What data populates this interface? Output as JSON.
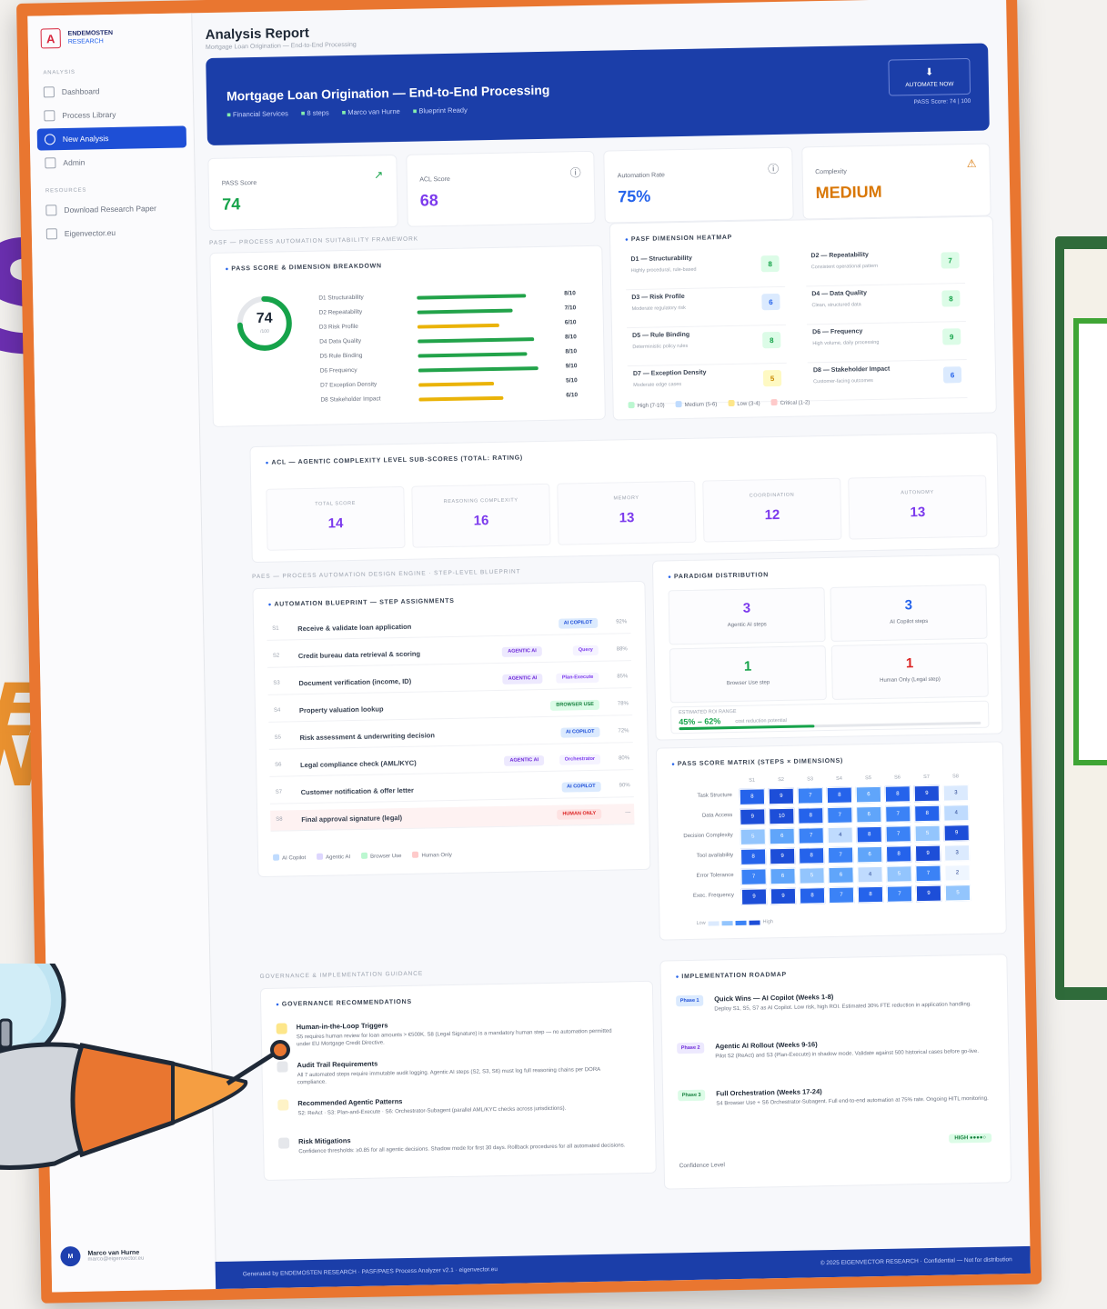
{
  "app": {
    "brand_line1": "ENDEMOSTEN",
    "brand_line2": "RESEARCH",
    "logo_glyph": "A"
  },
  "sidebar": {
    "group_analysis": "ANALYSIS",
    "items": [
      {
        "label": "Dashboard",
        "icon": "grid-icon",
        "active": false
      },
      {
        "label": "Process Library",
        "icon": "folder-icon",
        "active": false
      },
      {
        "label": "New Analysis",
        "icon": "plus-circle-icon",
        "active": true
      },
      {
        "label": "Admin",
        "icon": "chart-icon",
        "active": false
      }
    ],
    "group_resources": "RESOURCES",
    "resources": [
      {
        "label": "Download Research Paper",
        "icon": "download-icon"
      },
      {
        "label": "Eigenvector.eu",
        "icon": "link-icon"
      }
    ],
    "user_initials": "M",
    "user_name": "Marco van Hurne",
    "user_email": "marco@eigenvector.eu"
  },
  "header": {
    "title": "Analysis Report",
    "breadcrumb": "Mortgage Loan Origination — End-to-End Processing"
  },
  "hero": {
    "title": "Mortgage Loan Origination — End-to-End Processing",
    "meta": [
      "Financial Services",
      "8 steps",
      "Marco van Hurne",
      "Blueprint Ready"
    ],
    "export_label": "AUTOMATE NOW",
    "score_line": "PASS Score: 74 | 100",
    "color": "#1b3ea9"
  },
  "kpis": [
    {
      "label": "PASS Score",
      "value": "74",
      "icon": "trend-up-icon",
      "color": "#16a34a"
    },
    {
      "label": "ACL Score",
      "value": "68",
      "icon": "info-icon",
      "color": "#7c3aed"
    },
    {
      "label": "Automation Rate",
      "value": "75%",
      "icon": "info-icon",
      "color": "#2563eb"
    },
    {
      "label": "Complexity",
      "value": "MEDIUM",
      "icon": "warning-icon",
      "color": "#d97706"
    }
  ],
  "pass_section": {
    "heading": "PASF — PROCESS AUTOMATION SUITABILITY FRAMEWORK",
    "card_title": "PASS SCORE & DIMENSION BREAKDOWN",
    "donut_value": "74",
    "donut_sub": "/100",
    "donut_fraction": 0.74,
    "dimensions": [
      {
        "label": "D1 Structurability",
        "value": "8/10",
        "score": 0.8,
        "color": "#22a34a"
      },
      {
        "label": "D2 Repeatability",
        "value": "7/10",
        "score": 0.7,
        "color": "#22a34a"
      },
      {
        "label": "D3 Risk Profile",
        "value": "6/10",
        "score": 0.6,
        "color": "#eab308"
      },
      {
        "label": "D4 Data Quality",
        "value": "8/10",
        "score": 0.85,
        "color": "#22a34a"
      },
      {
        "label": "D5 Rule Binding",
        "value": "8/10",
        "score": 0.8,
        "color": "#22a34a"
      },
      {
        "label": "D6 Frequency",
        "value": "9/10",
        "score": 0.88,
        "color": "#22a34a"
      },
      {
        "label": "D7 Exception Density",
        "value": "5/10",
        "score": 0.55,
        "color": "#eab308"
      },
      {
        "label": "D8 Stakeholder Impact",
        "value": "6/10",
        "score": 0.62,
        "color": "#eab308"
      }
    ]
  },
  "heatmap": {
    "title": "PASF DIMENSION HEATMAP",
    "cells": [
      {
        "title": "D1 — Structurability",
        "sub": "Highly procedural, rule-based",
        "value": "8",
        "bg": "#dcfce7",
        "fg": "#16a34a"
      },
      {
        "title": "D2 — Repeatability",
        "sub": "Consistent operational pattern",
        "value": "7",
        "bg": "#dcfce7",
        "fg": "#16a34a"
      },
      {
        "title": "D3 — Risk Profile",
        "sub": "Moderate regulatory risk",
        "value": "6",
        "bg": "#dbeafe",
        "fg": "#2563eb"
      },
      {
        "title": "D4 — Data Quality",
        "sub": "Clean, structured data",
        "value": "8",
        "bg": "#dcfce7",
        "fg": "#16a34a"
      },
      {
        "title": "D5 — Rule Binding",
        "sub": "Deterministic policy rules",
        "value": "8",
        "bg": "#dcfce7",
        "fg": "#16a34a"
      },
      {
        "title": "D6 — Frequency",
        "sub": "High volume, daily processing",
        "value": "9",
        "bg": "#dcfce7",
        "fg": "#16a34a"
      },
      {
        "title": "D7 — Exception Density",
        "sub": "Moderate edge cases",
        "value": "5",
        "bg": "#fef9c3",
        "fg": "#ca8a04"
      },
      {
        "title": "D8 — Stakeholder Impact",
        "sub": "Customer-facing outcomes",
        "value": "6",
        "bg": "#dbeafe",
        "fg": "#2563eb"
      }
    ],
    "legend": [
      {
        "label": "High (7-10)",
        "color": "#bbf7d0"
      },
      {
        "label": "Medium (5-6)",
        "color": "#bfdbfe"
      },
      {
        "label": "Low (3-4)",
        "color": "#fde68a"
      },
      {
        "label": "Critical (1-2)",
        "color": "#fecaca"
      }
    ]
  },
  "acl": {
    "title": "ACL — AGENTIC COMPLEXITY LEVEL SUB-SCORES (TOTAL: RATING)",
    "boxes": [
      {
        "label": "TOTAL SCORE",
        "value": "14"
      },
      {
        "label": "REASONING COMPLEXITY",
        "value": "16"
      },
      {
        "label": "MEMORY",
        "value": "13"
      },
      {
        "label": "COORDINATION",
        "value": "12"
      },
      {
        "label": "AUTONOMY",
        "value": "13"
      }
    ]
  },
  "paes": {
    "heading": "PAES — PROCESS AUTOMATION DESIGN ENGINE · STEP-LEVEL BLUEPRINT",
    "card_title": "AUTOMATION BLUEPRINT — STEP ASSIGNMENTS",
    "steps": [
      {
        "id": "S1",
        "name": "Receive & validate loan application",
        "badges": [
          {
            "text": "AI COPILOT",
            "bg": "#dbeafe",
            "fg": "#1d4ed8"
          }
        ],
        "conf": "92%",
        "human": false
      },
      {
        "id": "S2",
        "name": "Credit bureau data retrieval & scoring",
        "badges": [
          {
            "text": "AGENTIC AI",
            "bg": "#ede9fe",
            "fg": "#6d28d9"
          },
          {
            "text": "Query",
            "bg": "#f5f3ff",
            "fg": "#7c3aed"
          }
        ],
        "conf": "88%",
        "human": false
      },
      {
        "id": "S3",
        "name": "Document verification (income, ID)",
        "badges": [
          {
            "text": "AGENTIC AI",
            "bg": "#ede9fe",
            "fg": "#6d28d9"
          },
          {
            "text": "Plan-Execute",
            "bg": "#f5f3ff",
            "fg": "#7c3aed"
          }
        ],
        "conf": "85%",
        "human": false
      },
      {
        "id": "S4",
        "name": "Property valuation lookup",
        "badges": [
          {
            "text": "BROWSER USE",
            "bg": "#dcfce7",
            "fg": "#15803d"
          }
        ],
        "conf": "78%",
        "human": false
      },
      {
        "id": "S5",
        "name": "Risk assessment & underwriting decision",
        "badges": [
          {
            "text": "AI COPILOT",
            "bg": "#dbeafe",
            "fg": "#1d4ed8"
          }
        ],
        "conf": "72%",
        "human": false
      },
      {
        "id": "S6",
        "name": "Legal compliance check (AML/KYC)",
        "badges": [
          {
            "text": "AGENTIC AI",
            "bg": "#ede9fe",
            "fg": "#6d28d9"
          },
          {
            "text": "Orchestrator",
            "bg": "#f5f3ff",
            "fg": "#7c3aed"
          }
        ],
        "conf": "80%",
        "human": false
      },
      {
        "id": "S7",
        "name": "Customer notification & offer letter",
        "badges": [
          {
            "text": "AI COPILOT",
            "bg": "#dbeafe",
            "fg": "#1d4ed8"
          }
        ],
        "conf": "90%",
        "human": false
      },
      {
        "id": "S8",
        "name": "Final approval signature (legal)",
        "badges": [
          {
            "text": "HUMAN ONLY",
            "bg": "#fee2e2",
            "fg": "#dc2626"
          }
        ],
        "conf": "—",
        "human": true
      }
    ],
    "legend": [
      {
        "label": "AI Copilot",
        "color": "#bfdbfe"
      },
      {
        "label": "Agentic AI",
        "color": "#ddd6fe"
      },
      {
        "label": "Browser Use",
        "color": "#bbf7d0"
      },
      {
        "label": "Human Only",
        "color": "#fecaca"
      }
    ]
  },
  "paradigm": {
    "title": "PARADIGM DISTRIBUTION",
    "boxes": [
      {
        "value": "3",
        "label": "Agentic AI steps",
        "color": "#7c3aed"
      },
      {
        "value": "3",
        "label": "AI Copilot steps",
        "color": "#2563eb"
      },
      {
        "value": "1",
        "label": "Browser Use step",
        "color": "#16a34a"
      },
      {
        "value": "1",
        "label": "Human Only (Legal step)",
        "color": "#dc2626"
      }
    ],
    "range_label": "ESTIMATED ROI RANGE",
    "range_value": "45% – 62%",
    "range_note": "cost reduction potential",
    "range_fraction": 0.45
  },
  "matrix": {
    "title": "PASS SCORE MATRIX (STEPS × DIMENSIONS)",
    "columns": [
      "S1",
      "S2",
      "S3",
      "S4",
      "S5",
      "S6",
      "S7",
      "S8"
    ],
    "rows": [
      {
        "label": "Task Structure",
        "values": [
          8,
          9,
          7,
          8,
          6,
          8,
          9,
          3
        ]
      },
      {
        "label": "Data Access",
        "values": [
          9,
          10,
          8,
          7,
          6,
          7,
          8,
          4
        ]
      },
      {
        "label": "Decision Complexity",
        "values": [
          5,
          6,
          7,
          4,
          8,
          7,
          5,
          9
        ]
      },
      {
        "label": "Tool availability",
        "values": [
          8,
          9,
          8,
          7,
          6,
          8,
          9,
          3
        ]
      },
      {
        "label": "Error Tolerance",
        "values": [
          7,
          6,
          5,
          6,
          4,
          5,
          7,
          2
        ]
      },
      {
        "label": "Exec. Frequency",
        "values": [
          9,
          9,
          8,
          7,
          8,
          7,
          9,
          5
        ]
      }
    ],
    "scale_low": "Low",
    "scale_high": "High"
  },
  "governance": {
    "heading": "GOVERNANCE & IMPLEMENTATION GUIDANCE",
    "card_title": "GOVERNANCE RECOMMENDATIONS",
    "items": [
      {
        "title": "Human-in-the-Loop Triggers",
        "desc": "S5 requires human review for loan amounts > €500K. S8 (Legal Signature) is a mandatory human step — no automation permitted under EU Mortgage Credit Directive.",
        "icon": "person-icon",
        "color": "#fde68a"
      },
      {
        "title": "Audit Trail Requirements",
        "desc": "All 7 automated steps require immutable audit logging. Agentic AI steps (S2, S3, S6) must log full reasoning chains per DORA compliance.",
        "icon": "document-icon",
        "color": "#e5e7eb"
      },
      {
        "title": "Recommended Agentic Patterns",
        "desc": "S2: ReAct · S3: Plan-and-Execute · S6: Orchestrator-Subagent (parallel AML/KYC checks across jurisdictions).",
        "icon": "spark-icon",
        "color": "#fef3c7"
      },
      {
        "title": "Risk Mitigations",
        "desc": "Confidence thresholds: ≥0.85 for all agentic decisions. Shadow mode for first 30 days. Rollback procedures for all automated decisions.",
        "icon": "shield-icon",
        "color": "#e5e7eb"
      }
    ]
  },
  "roadmap": {
    "card_title": "IMPLEMENTATION ROADMAP",
    "phases": [
      {
        "badge": "Phase 1",
        "title": "Quick Wins — AI Copilot (Weeks 1-8)",
        "desc": "Deploy S1, S5, S7 as AI Copilot. Low risk, high ROI. Estimated 30% FTE reduction in application handling.",
        "bg": "#dbeafe",
        "fg": "#1d4ed8"
      },
      {
        "badge": "Phase 2",
        "title": "Agentic AI Rollout (Weeks 9-16)",
        "desc": "Pilot S2 (ReAct) and S3 (Plan-Execute) in shadow mode. Validate against 500 historical cases before go-live.",
        "bg": "#ede9fe",
        "fg": "#6d28d9"
      },
      {
        "badge": "Phase 3",
        "title": "Full Orchestration (Weeks 17-24)",
        "desc": "S4 Browser Use + S6 Orchestrator-Subagent. Full end-to-end automation at 75% rate. Ongoing HITL monitoring.",
        "bg": "#dcfce7",
        "fg": "#15803d"
      }
    ],
    "confidence_label": "Confidence Level",
    "confidence_value": "HIGH ●●●●○"
  },
  "footer": {
    "left": "Generated by ENDEMOSTEN RESEARCH · PASF/PAES Process Analyzer v2.1 · eigenvector.eu",
    "right": "© 2025 EIGENVECTOR RESEARCH · Confidential — Not for distribution"
  },
  "background": {
    "word_top": "S",
    "word_mid": "E",
    "word_low": "N/"
  }
}
